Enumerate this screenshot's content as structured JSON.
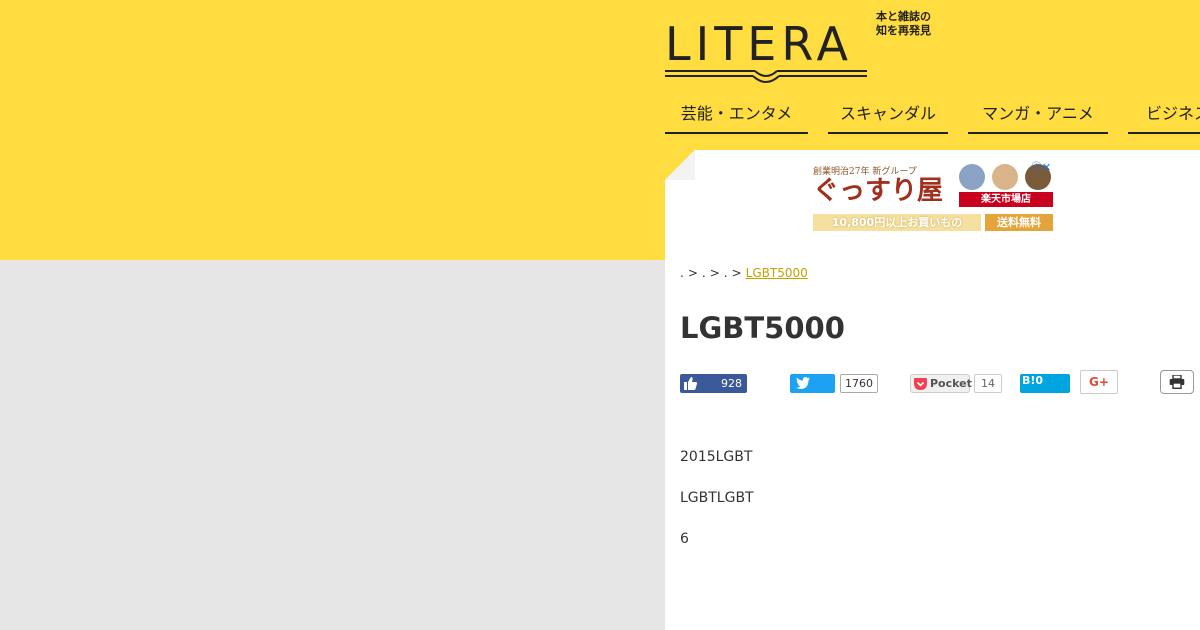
{
  "header": {
    "logo_text": "LITERA",
    "tagline_line1": "本と雑誌の",
    "tagline_line2": "知を再発見"
  },
  "nav": {
    "items": [
      {
        "label": "芸能・エンタメ"
      },
      {
        "label": "スキャンダル"
      },
      {
        "label": "マンガ・アニメ"
      },
      {
        "label": "ビジネス"
      }
    ]
  },
  "ad": {
    "top_text": "創業明治27年 新グループ",
    "title": "ぐっすり屋",
    "store": "楽天市場店",
    "offer": "10,800円以上お買いもの",
    "shipping": "送料無料"
  },
  "breadcrumb": {
    "sep": ">",
    "current": "LGBT5000"
  },
  "article": {
    "title": "LGBT5000",
    "paragraphs": [
      "2015LGBT",
      "LGBTLGBT",
      "6"
    ]
  },
  "share": {
    "facebook_count": "928",
    "twitter_count": "1760",
    "pocket_label": "Pocket",
    "pocket_count": "14",
    "hatena_label": "B!",
    "hatena_count": "0",
    "gplus_label": "G+"
  },
  "colors": {
    "brand_yellow": "#ffdc3f",
    "background": "#e6e6e6",
    "facebook": "#3b5998",
    "twitter": "#1da1f2",
    "hatena": "#00a4de",
    "link": "#c8a000"
  },
  "icons": [
    "thumbs-up-icon",
    "twitter-bird-icon",
    "pocket-icon",
    "print-icon",
    "ad-choices-icon",
    "open-book-icon"
  ]
}
